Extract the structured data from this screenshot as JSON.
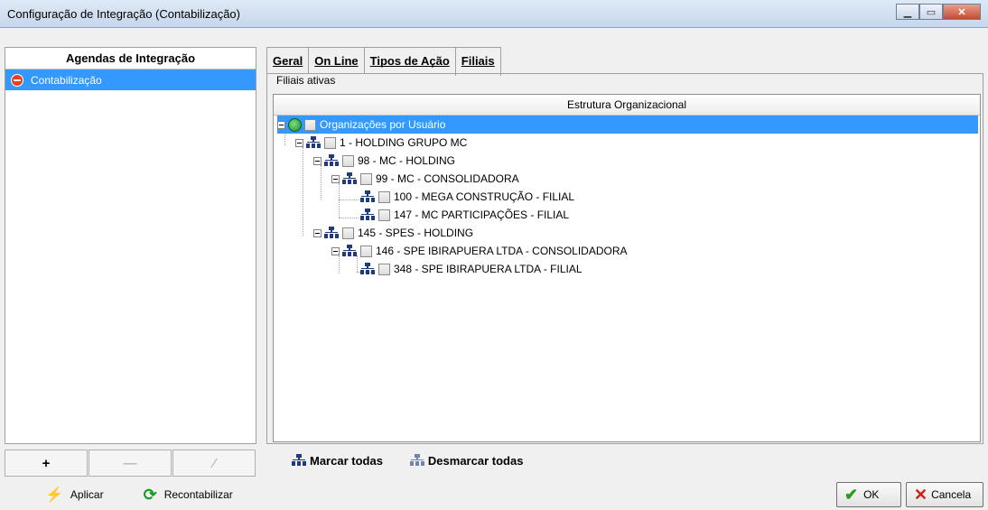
{
  "window": {
    "title": "Configuração de Integração (Contabilização)"
  },
  "left_panel": {
    "header": "Agendas de Integração",
    "items": [
      {
        "label": "Contabilização"
      }
    ],
    "buttons": [
      {
        "label": "+",
        "enabled": true
      },
      {
        "label": "—",
        "enabled": false
      },
      {
        "label": "⁄",
        "enabled": false
      }
    ]
  },
  "tabs": [
    {
      "label": "Geral",
      "active": false
    },
    {
      "label": "On Line",
      "active": false
    },
    {
      "label": "Tipos de Ação",
      "active": false
    },
    {
      "label": "Filiais",
      "active": true
    }
  ],
  "filiais": {
    "group_label": "Filiais ativas",
    "column_header": "Estrutura Organizacional",
    "tree": [
      {
        "label": "Organizações por Usuário",
        "selected": true
      },
      {
        "label": "1 - HOLDING GRUPO MC"
      },
      {
        "label": "98 - MC - HOLDING"
      },
      {
        "label": "99 - MC - CONSOLIDADORA"
      },
      {
        "label": "100 - MEGA CONSTRUÇÃO - FILIAL"
      },
      {
        "label": "147 - MC PARTICIPAÇÕES - FILIAL"
      },
      {
        "label": "145 - SPES - HOLDING"
      },
      {
        "label": "146 - SPE IBIRAPUERA LTDA - CONSOLIDADORA"
      },
      {
        "label": "348 - SPE IBIRAPUERA LTDA - FILIAL"
      }
    ],
    "mark_all": "Marcar todas",
    "unmark_all": "Desmarcar todas"
  },
  "footer": {
    "apply": "Aplicar",
    "recontabilizar": "Recontabilizar",
    "ok": "OK",
    "cancel": "Cancela"
  },
  "colors": {
    "selection": "#3399ff",
    "icon_blue": "#1f3b80",
    "stop_red": "#e8401c"
  }
}
